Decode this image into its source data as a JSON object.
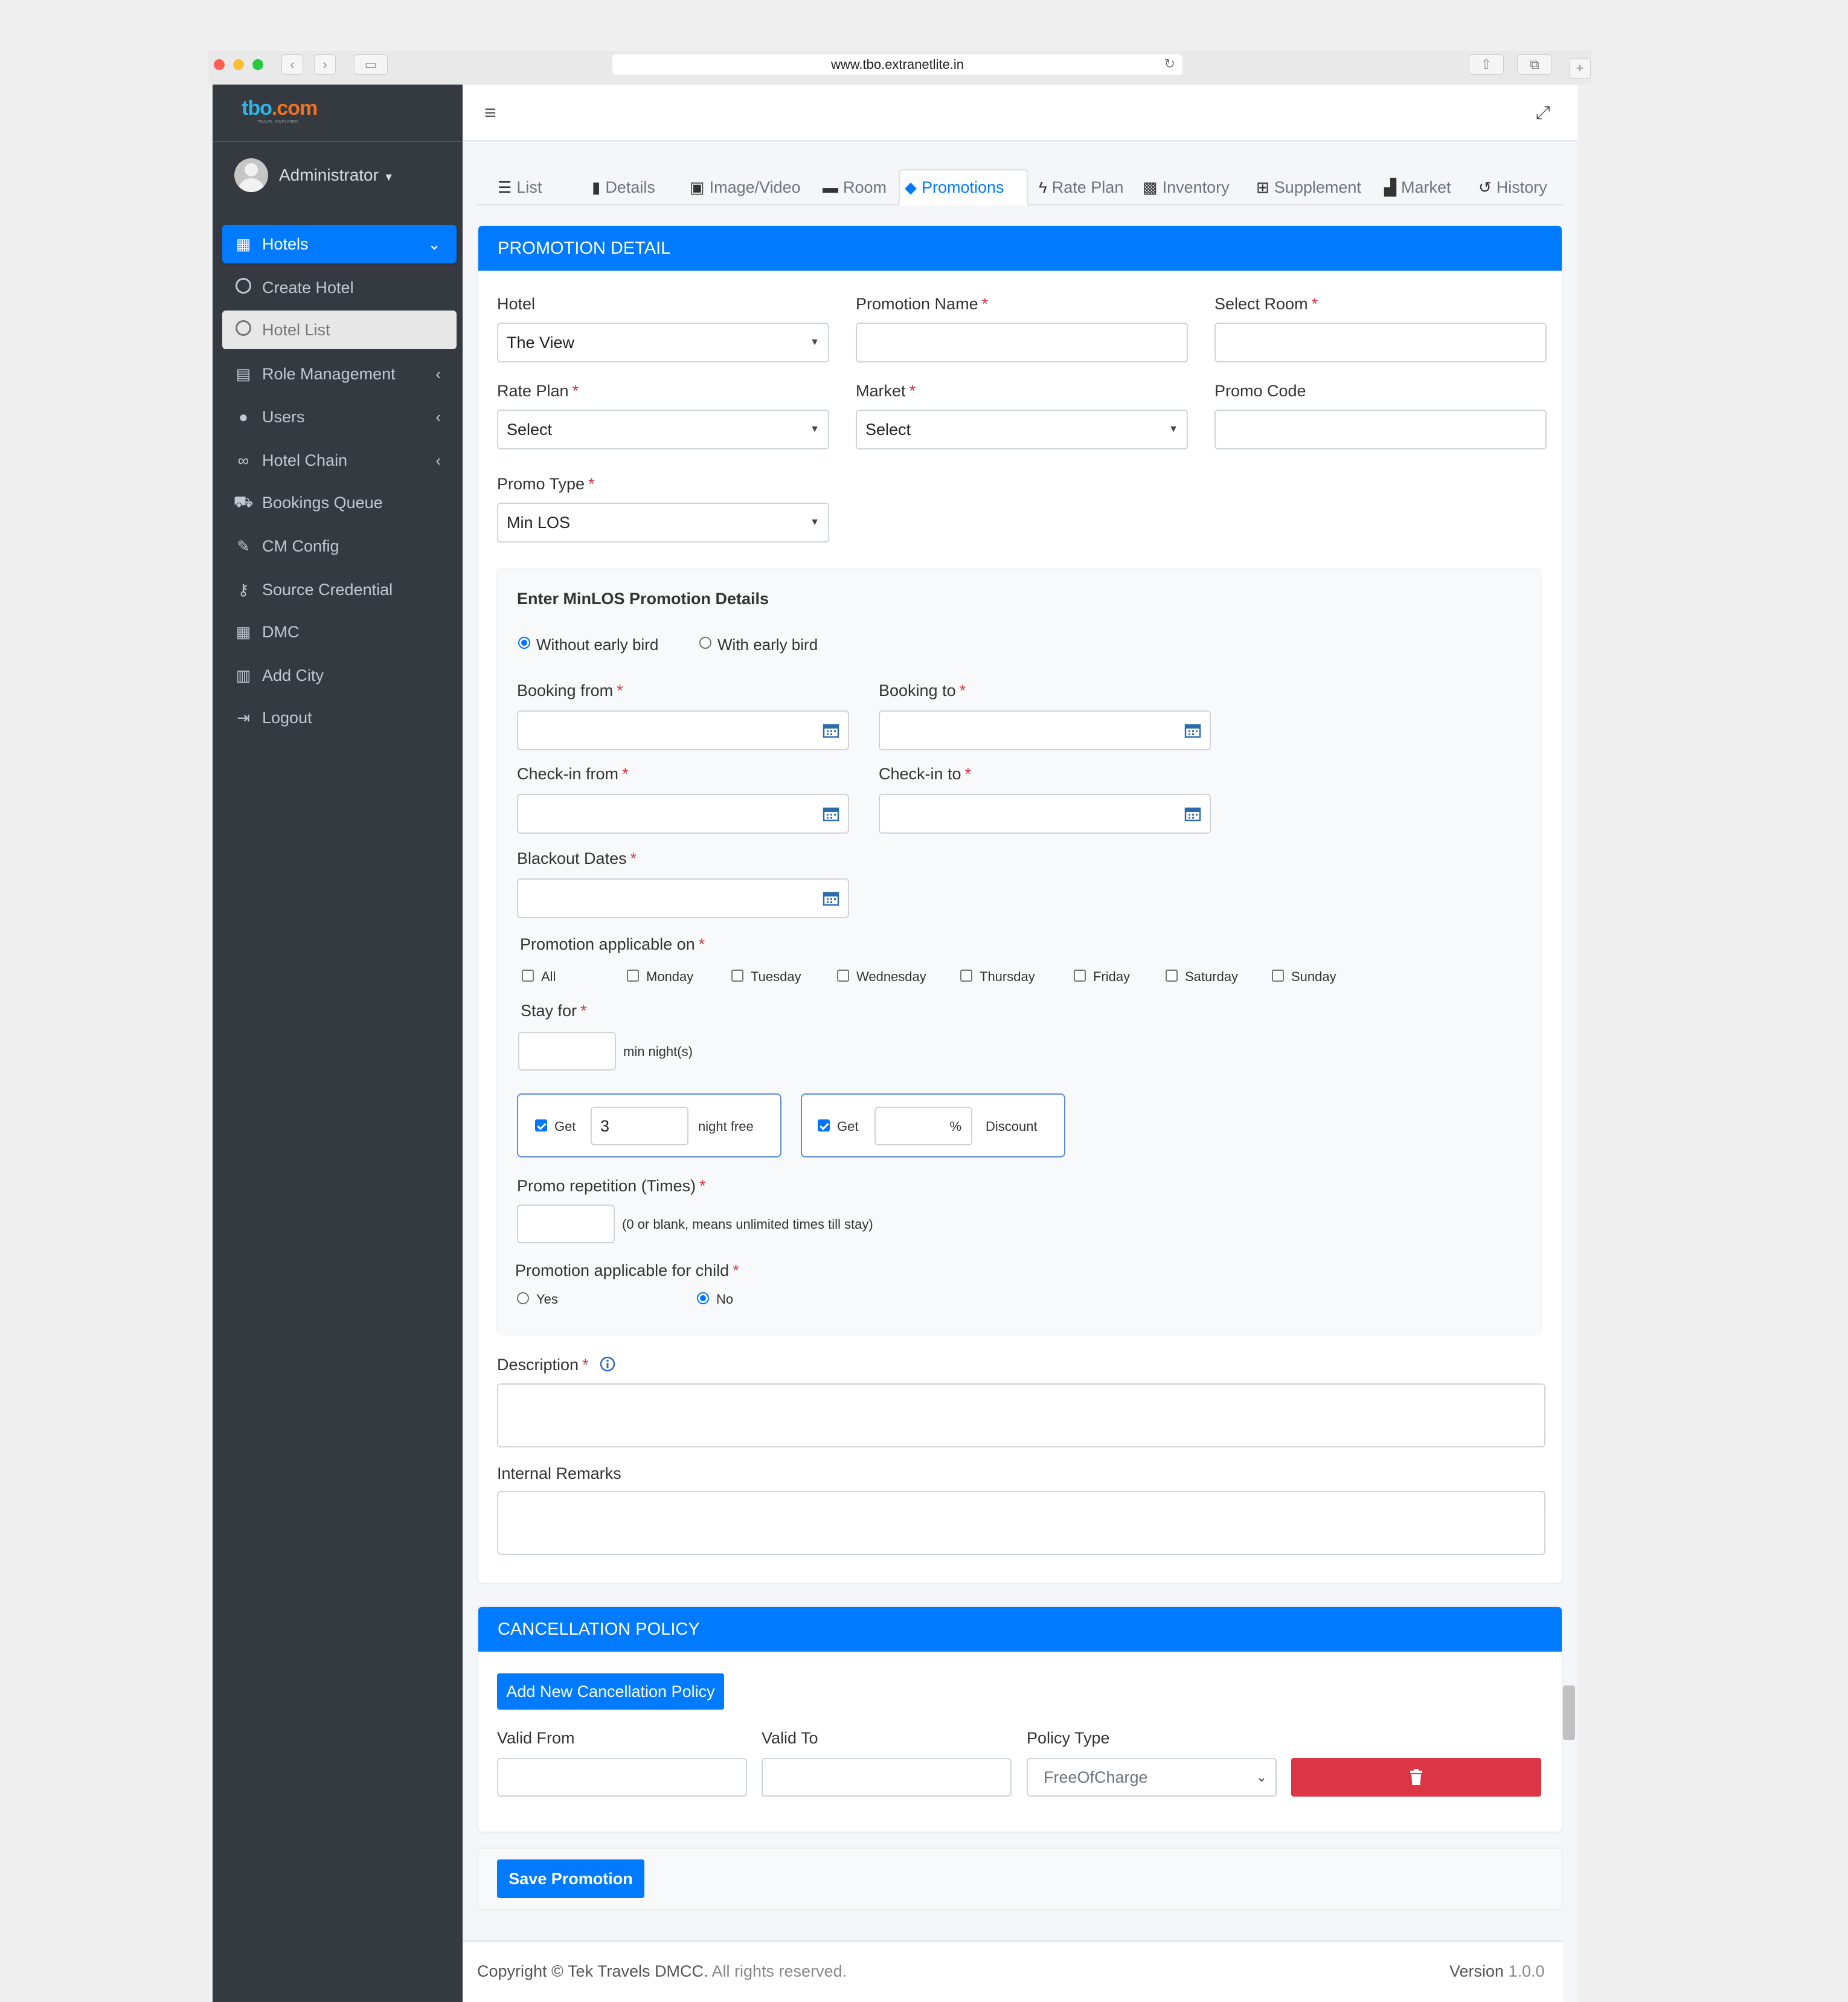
{
  "browser": {
    "url": "www.tbo.extranetlite.in"
  },
  "sidebar": {
    "logo_text_main": "tbo",
    "logo_text_dot": ".com",
    "logo_tagline": "TRAVEL SIMPLIFIED",
    "user": "Administrator",
    "items": [
      {
        "label": "Hotels",
        "icon": "building-icon"
      },
      {
        "label": "Create Hotel",
        "icon": "circle-icon"
      },
      {
        "label": "Hotel List",
        "icon": "circle-icon"
      },
      {
        "label": "Role Management",
        "icon": "clipboard-icon"
      },
      {
        "label": "Users",
        "icon": "user-icon"
      },
      {
        "label": "Hotel Chain",
        "icon": "link-icon"
      },
      {
        "label": "Bookings Queue",
        "icon": "cart-icon"
      },
      {
        "label": "CM Config",
        "icon": "brush-icon"
      },
      {
        "label": "Source Credential",
        "icon": "key-icon"
      },
      {
        "label": "DMC",
        "icon": "building-icon"
      },
      {
        "label": "Add City",
        "icon": "city-icon"
      },
      {
        "label": "Logout",
        "icon": "sign-out-icon"
      }
    ]
  },
  "tabs": [
    {
      "label": "List",
      "icon": "list-icon"
    },
    {
      "label": "Details",
      "icon": "file-icon"
    },
    {
      "label": "Image/Video",
      "icon": "image-icon"
    },
    {
      "label": "Room",
      "icon": "bed-icon"
    },
    {
      "label": "Promotions",
      "icon": "tags-icon",
      "active": true
    },
    {
      "label": "Rate Plan",
      "icon": "bolt-icon"
    },
    {
      "label": "Inventory",
      "icon": "boxes-icon"
    },
    {
      "label": "Supplement",
      "icon": "plus-square-icon"
    },
    {
      "label": "Market",
      "icon": "chart-icon"
    },
    {
      "label": "History",
      "icon": "history-icon"
    }
  ],
  "promotion": {
    "header": "PROMOTION DETAIL",
    "hotel_label": "Hotel",
    "hotel_value": "The View",
    "promo_name_label": "Promotion Name",
    "promo_name_value": "",
    "select_room_label": "Select Room",
    "select_room_value": "",
    "rate_plan_label": "Rate Plan",
    "rate_plan_value": "Select",
    "market_label": "Market",
    "market_value": "Select",
    "promo_code_label": "Promo Code",
    "promo_code_value": "",
    "promo_type_label": "Promo Type",
    "promo_type_value": "Min LOS",
    "req_mark": "*"
  },
  "minlos": {
    "title": "Enter MinLOS Promotion Details",
    "radio_without": "Without early bird",
    "radio_with": "With early bird",
    "booking_from": "Booking from",
    "booking_to": "Booking to",
    "checkin_from": "Check-in from",
    "checkin_to": "Check-in to",
    "blackout": "Blackout Dates",
    "applicable_on": "Promotion applicable on",
    "days": [
      "All",
      "Monday",
      "Tuesday",
      "Wednesday",
      "Thursday",
      "Friday",
      "Saturday",
      "Sunday"
    ],
    "stay_for": "Stay for",
    "stay_value": "",
    "min_nights": "min night(s)",
    "get1_label": "Get",
    "get1_value": "3",
    "night_free": "night free",
    "get2_label": "Get",
    "get2_value": "",
    "percent": "%",
    "discount": "Discount",
    "repetition_label": "Promo repetition (Times)",
    "repetition_value": "",
    "repetition_hint": "(0 or blank, means unlimited times till stay)",
    "child_label": "Promotion applicable for child",
    "child_yes": "Yes",
    "child_no": "No"
  },
  "description": {
    "label": "Description",
    "value": ""
  },
  "internal_remarks": {
    "label": "Internal Remarks",
    "value": ""
  },
  "cancellation": {
    "header": "CANCELLATION POLICY",
    "add_button": "Add New Cancellation Policy",
    "valid_from_label": "Valid From",
    "valid_to_label": "Valid To",
    "policy_type_label": "Policy Type",
    "policy_type_value": "FreeOfCharge"
  },
  "save_button": "Save Promotion",
  "footer": {
    "copyright": "Copyright © Tek Travels DMCC.",
    "rights": "All rights reserved.",
    "version_label": "Version",
    "version_value": "1.0.0"
  },
  "colors": {
    "primary": "#007bff",
    "sidebar": "#343a40",
    "danger": "#dc3545"
  }
}
